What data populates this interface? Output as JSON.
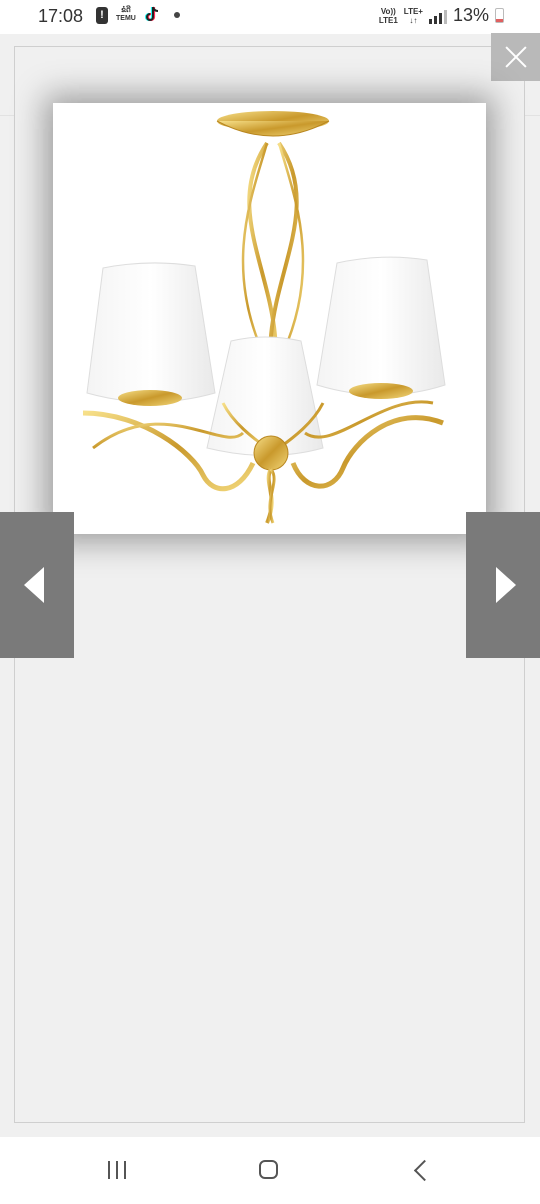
{
  "status_bar": {
    "time": "17:08",
    "temu_label_top": "ຂໍດີ",
    "temu_label_bottom": "TEMU",
    "volte_label_top": "Vo))",
    "volte_label_bottom": "LTE1",
    "network_label": "LTE+",
    "battery_percent": "13%"
  },
  "colors": {
    "overlay_bg": "#f0f0f0",
    "nav_button_bg": "#7a7a7a",
    "close_button_bg": "#b9b9b9",
    "gold": "#d4af37",
    "shade": "#ffffff"
  },
  "viewer": {
    "image_alt": "chandelier-photo",
    "close_icon": "close-icon",
    "prev_icon": "chevron-left-icon",
    "next_icon": "chevron-right-icon"
  },
  "navigation": {
    "recents_icon": "recents-icon",
    "home_icon": "home-icon",
    "back_icon": "back-icon"
  }
}
